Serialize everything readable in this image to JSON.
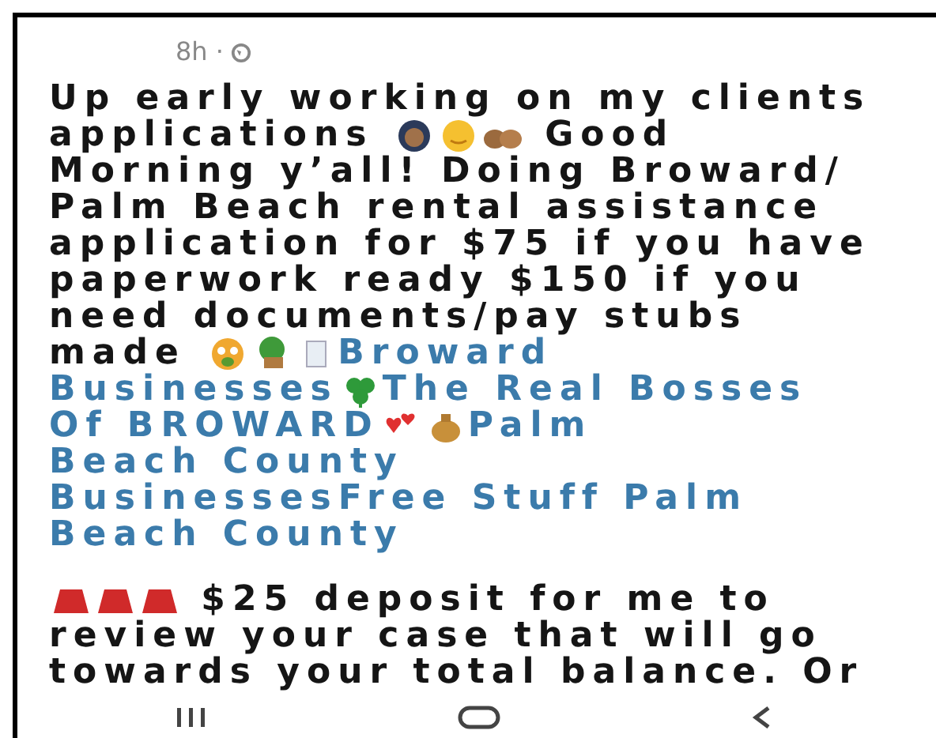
{
  "post": {
    "time": "8h ·",
    "paragraphs": [
      [
        [
          {
            "kind": "text",
            "text": "Up early working on my clients"
          }
        ],
        [
          {
            "kind": "text",
            "text": "applications "
          },
          {
            "kind": "icon"
          },
          {
            "kind": "icon"
          },
          {
            "kind": "icon"
          },
          {
            "kind": "text",
            "text": " Good"
          }
        ],
        [
          {
            "kind": "text",
            "text": "Morning y’all! Doing Broward/"
          }
        ],
        [
          {
            "kind": "text",
            "text": "Palm Beach rental assistance"
          }
        ],
        [
          {
            "kind": "text",
            "text": "application for $75 if you have"
          }
        ],
        [
          {
            "kind": "text",
            "text": "paperwork ready $150 if you"
          }
        ],
        [
          {
            "kind": "text",
            "text": "need documents/pay stubs"
          }
        ],
        [
          {
            "kind": "text",
            "text": "made "
          },
          {
            "kind": "icon"
          },
          {
            "kind": "icon"
          },
          {
            "kind": "icon"
          },
          {
            "kind": "link",
            "text": "Broward"
          }
        ],
        [
          {
            "kind": "link",
            "text": "Businesses"
          },
          {
            "kind": "icon"
          },
          {
            "kind": "link",
            "text": "The Real Bosses"
          }
        ],
        [
          {
            "kind": "link",
            "text": "Of BROWARD"
          },
          {
            "kind": "icon"
          },
          {
            "kind": "icon"
          },
          {
            "kind": "link",
            "text": "Palm"
          }
        ],
        [
          {
            "kind": "link",
            "text": "Beach County"
          }
        ],
        [
          {
            "kind": "link",
            "text": "BusinessesFree Stuff Palm"
          }
        ],
        [
          {
            "kind": "link",
            "text": "Beach County"
          }
        ]
      ],
      [
        [
          {
            "kind": "icon"
          },
          {
            "kind": "icon"
          },
          {
            "kind": "icon"
          },
          {
            "kind": "text",
            "text": " $25 deposit for me to"
          }
        ],
        [
          {
            "kind": "text",
            "text": "review your case that will go"
          }
        ],
        [
          {
            "kind": "text",
            "text": "towards your total balance. Or"
          }
        ]
      ]
    ]
  }
}
